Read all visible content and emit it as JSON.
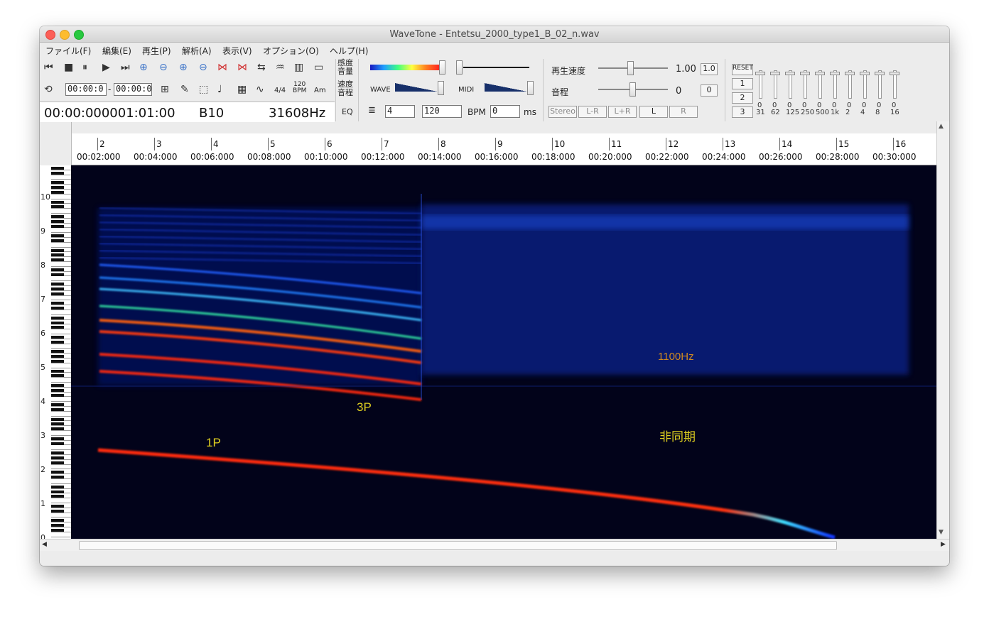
{
  "window": {
    "title": "WaveTone - Entetsu_2000_type1_B_02_n.wav"
  },
  "menu": [
    "ファイル(F)",
    "編集(E)",
    "再生(P)",
    "解析(A)",
    "表示(V)",
    "オプション(O)",
    "ヘルプ(H)"
  ],
  "transport": {
    "time_start": "00:00:0",
    "time_end": "00:00:0",
    "time_sig": "4/4",
    "bpm_label_small": "120\nBPM",
    "chord_label": "Am",
    "position_readout": "00:00:000001:01:00",
    "note_readout": "B10",
    "freq_readout": "31608Hz"
  },
  "labels": {
    "sensitivity": "感度",
    "volume": "音量",
    "speed": "速度",
    "pitch_kanji": "音程",
    "eq": "EQ",
    "wave": "WAVE",
    "midi": "MIDI",
    "bpm": "BPM",
    "ms": "ms",
    "playback_speed": "再生速度",
    "pitch": "音程"
  },
  "controls": {
    "beats_value": "4",
    "tempo_value": "120",
    "offset_value": "0",
    "playback_speed_value": "1.00",
    "playback_speed_reset": "1.0",
    "pitch_value": "0",
    "pitch_reset": "0"
  },
  "channel_buttons": [
    "Stereo",
    "L-R",
    "L+R",
    "L",
    "R"
  ],
  "eq": {
    "reset": "RESET",
    "presets": [
      "1",
      "2",
      "3"
    ],
    "band_values": [
      "0",
      "0",
      "0",
      "0",
      "0",
      "0",
      "0",
      "0",
      "0",
      "0"
    ],
    "band_labels": [
      "31",
      "62",
      "125",
      "250",
      "500",
      "1k",
      "2",
      "4",
      "8",
      "16"
    ]
  },
  "ruler": {
    "measures": [
      "2",
      "3",
      "4",
      "5",
      "6",
      "7",
      "8",
      "9",
      "10",
      "11",
      "12",
      "13",
      "14",
      "15",
      "16"
    ],
    "times": [
      "00:02:000",
      "00:04:000",
      "00:06:000",
      "00:08:000",
      "00:10:000",
      "00:12:000",
      "00:14:000",
      "00:16:000",
      "00:18:000",
      "00:20:000",
      "00:22:000",
      "00:24:000",
      "00:26:000",
      "00:28:000",
      "00:30:000"
    ]
  },
  "octave_labels": [
    "10",
    "9",
    "8",
    "7",
    "6",
    "5",
    "4",
    "3",
    "2",
    "1",
    "0"
  ],
  "annotations": {
    "p1": "1P",
    "p3": "3P",
    "hz1100": "1100Hz",
    "async": "非同期"
  },
  "colors": {
    "annotation_yellow": "#e0d020",
    "annotation_orange": "#d08a20",
    "spectrogram_bg": "#02031a"
  }
}
